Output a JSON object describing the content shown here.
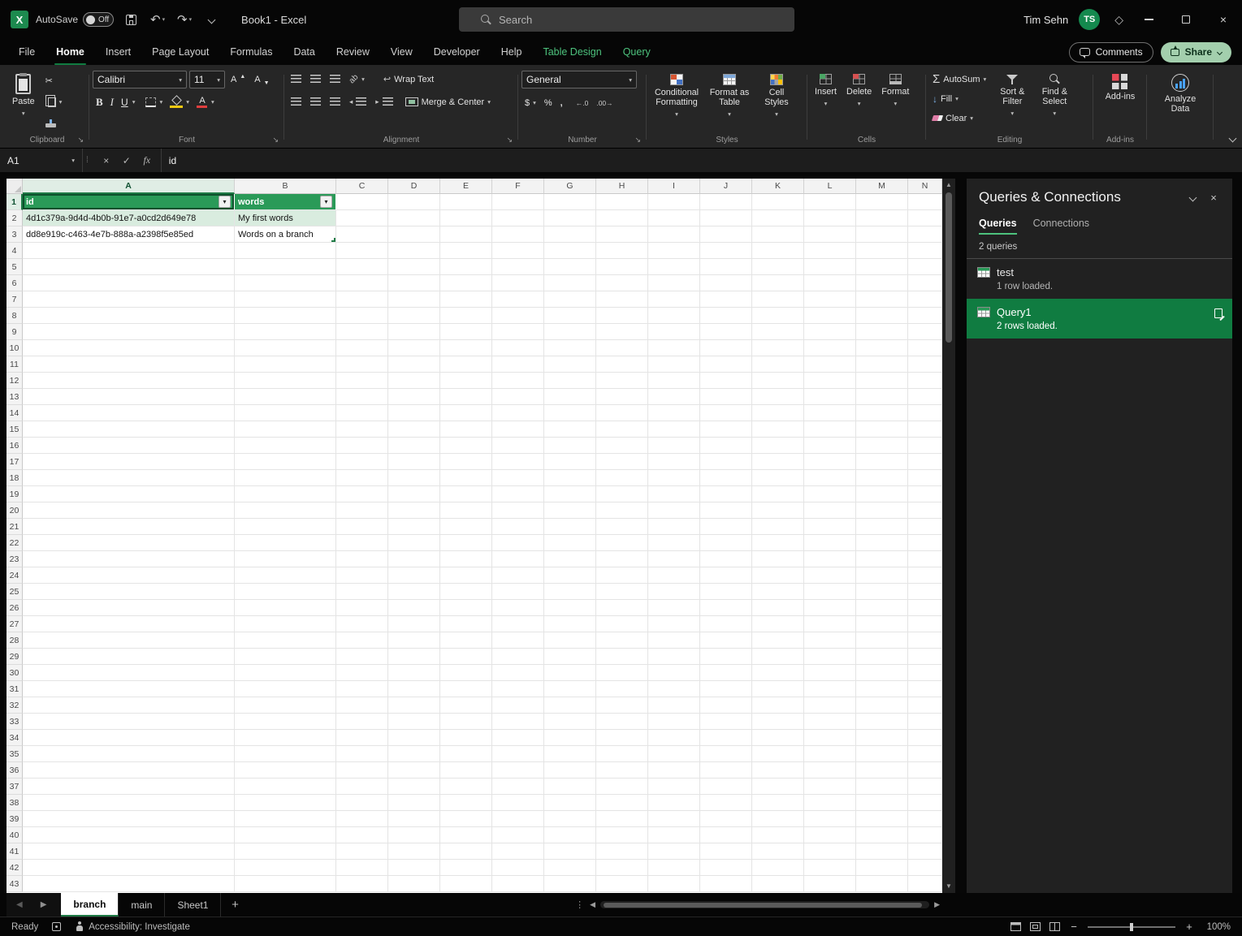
{
  "titlebar": {
    "autosave_label": "AutoSave",
    "autosave_state": "Off",
    "doc_title": "Book1 - Excel",
    "search_placeholder": "Search",
    "user_name": "Tim Sehn",
    "user_initials": "TS"
  },
  "ribbon_tabs": {
    "items": [
      {
        "label": "File",
        "active": false,
        "contextual": false
      },
      {
        "label": "Home",
        "active": true,
        "contextual": false
      },
      {
        "label": "Insert",
        "active": false,
        "contextual": false
      },
      {
        "label": "Page Layout",
        "active": false,
        "contextual": false
      },
      {
        "label": "Formulas",
        "active": false,
        "contextual": false
      },
      {
        "label": "Data",
        "active": false,
        "contextual": false
      },
      {
        "label": "Review",
        "active": false,
        "contextual": false
      },
      {
        "label": "View",
        "active": false,
        "contextual": false
      },
      {
        "label": "Developer",
        "active": false,
        "contextual": false
      },
      {
        "label": "Help",
        "active": false,
        "contextual": false
      },
      {
        "label": "Table Design",
        "active": false,
        "contextual": true
      },
      {
        "label": "Query",
        "active": false,
        "contextual": true
      }
    ],
    "comments_label": "Comments",
    "share_label": "Share"
  },
  "ribbon": {
    "clipboard": {
      "group_label": "Clipboard",
      "paste_label": "Paste"
    },
    "font": {
      "group_label": "Font",
      "font_name": "Calibri",
      "font_size": "11"
    },
    "alignment": {
      "group_label": "Alignment",
      "wrap_text_label": "Wrap Text",
      "merge_center_label": "Merge & Center"
    },
    "number": {
      "group_label": "Number",
      "format_value": "General"
    },
    "styles": {
      "group_label": "Styles",
      "conditional_label": "Conditional Formatting",
      "format_table_label": "Format as Table",
      "cell_styles_label": "Cell Styles"
    },
    "cells": {
      "group_label": "Cells",
      "insert_label": "Insert",
      "delete_label": "Delete",
      "format_label": "Format"
    },
    "editing": {
      "group_label": "Editing",
      "autosum_label": "AutoSum",
      "fill_label": "Fill",
      "clear_label": "Clear",
      "sort_filter_label": "Sort & Filter",
      "find_select_label": "Find & Select"
    },
    "addins": {
      "group_label": "Add-ins",
      "button_label": "Add-ins"
    },
    "analyze": {
      "button_label": "Analyze Data"
    }
  },
  "formula_bar": {
    "name_box": "A1",
    "content": "id"
  },
  "grid": {
    "columns": [
      "A",
      "B",
      "C",
      "D",
      "E",
      "F",
      "G",
      "H",
      "I",
      "J",
      "K",
      "L",
      "M",
      "N"
    ],
    "row_count": 43,
    "active_cell": "A1",
    "table": {
      "headers": [
        "id",
        "words"
      ],
      "rows": [
        [
          "4d1c379a-9d4d-4b0b-91e7-a0cd2d649e78",
          "My first words"
        ],
        [
          "dd8e919c-c463-4e7b-888a-a2398f5e85ed",
          "Words on a branch"
        ]
      ]
    }
  },
  "queries_panel": {
    "title": "Queries & Connections",
    "tabs": [
      {
        "label": "Queries",
        "active": true
      },
      {
        "label": "Connections",
        "active": false
      }
    ],
    "count_label": "2 queries",
    "queries": [
      {
        "name": "test",
        "status": "1 row loaded.",
        "selected": false
      },
      {
        "name": "Query1",
        "status": "2 rows loaded.",
        "selected": true
      }
    ]
  },
  "sheet_bar": {
    "tabs": [
      {
        "label": "branch",
        "active": true
      },
      {
        "label": "main",
        "active": false
      },
      {
        "label": "Sheet1",
        "active": false
      }
    ]
  },
  "status_bar": {
    "ready_label": "Ready",
    "accessibility_label": "Accessibility: Investigate",
    "zoom_value": "100%"
  },
  "colors": {
    "accent_green": "#107c41",
    "table_header_green": "#2a9a58",
    "banded_row_green": "#d9ecdf"
  }
}
